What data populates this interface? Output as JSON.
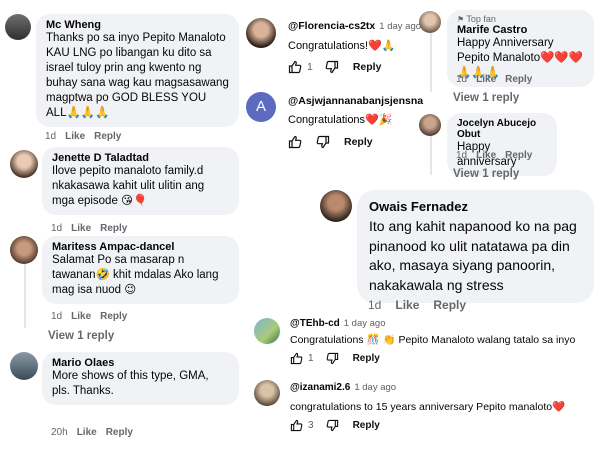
{
  "fb": [
    {
      "name": "Mc Wheng",
      "text": "Thanks po sa inyo Pepito Manaloto KAU LNG po libangan ku dito sa israel tuloy prin ang kwento ng buhay sana wag kau magsasawang magptwa po GOD BLESS YOU ALL🙏🙏🙏",
      "time": "1d",
      "like": "Like",
      "reply": "Reply"
    },
    {
      "name": "Jenette D Taladtad",
      "text": "Ilove pepito manaloto family.d nkakasawa kahit ulit ulitin ang mga episode 😘🎈",
      "time": "1d",
      "like": "Like",
      "reply": "Reply"
    },
    {
      "name": "Maritess Ampac-dancel",
      "text": "Salamat Po sa masarap n tawanan🤣 khit mdalas Ako lang mag isa nuod 😉",
      "time": "1d",
      "like": "Like",
      "reply": "Reply",
      "view": "View 1 reply"
    },
    {
      "name": "Mario Olaes",
      "text": "More shows of this type, GMA, pls. Thanks.",
      "time": "20h",
      "like": "Like",
      "reply": "Reply"
    },
    {
      "name": "Marife Castro",
      "badge": "Top fan",
      "text": "Happy Anniversary Pepito Manaloto❤️❤️❤️🙏🙏🙏",
      "time": "1d",
      "like": "Like",
      "reply": "Reply",
      "view": "View 1 reply"
    },
    {
      "name": "Jocelyn Abucejo Obut",
      "text": "Happy anniversary",
      "time": "1d",
      "like": "Like",
      "reply": "Reply",
      "view": "View 1 reply"
    },
    {
      "name": "Owais Fernadez",
      "text": "Ito ang kahit napanood ko na pag pinanood ko ulit natatawa pa din ako, masaya siyang panoorin, nakakawala ng stress",
      "time": "1d",
      "like": "Like",
      "reply": "Reply"
    }
  ],
  "yt": [
    {
      "name": "@Florencia-cs2tx",
      "time": "1 day ago",
      "text": "Congratulations!❤️🙏",
      "likes": "1",
      "reply": "Reply"
    },
    {
      "name": "@Asjwjannanabanjsjensna",
      "time": "",
      "text": "Congratulations❤️🎉",
      "likes": "",
      "reply": "Reply",
      "avatar_letter": "A"
    },
    {
      "name": "@TEhb-cd",
      "time": "1 day ago",
      "text": "Congratulations 🎊 👏 Pepito Manaloto walang tatalo sa inyo",
      "likes": "1",
      "reply": "Reply"
    },
    {
      "name": "@izanami2.6",
      "time": "1 day ago",
      "text": "congratulations to 15 years anniversary Pepito manaloto❤️",
      "likes": "3",
      "reply": "Reply"
    }
  ],
  "colors": {
    "bubble": "#f0f2f5",
    "meta": "#65676b",
    "avatar_a": "#5c6bc0"
  }
}
